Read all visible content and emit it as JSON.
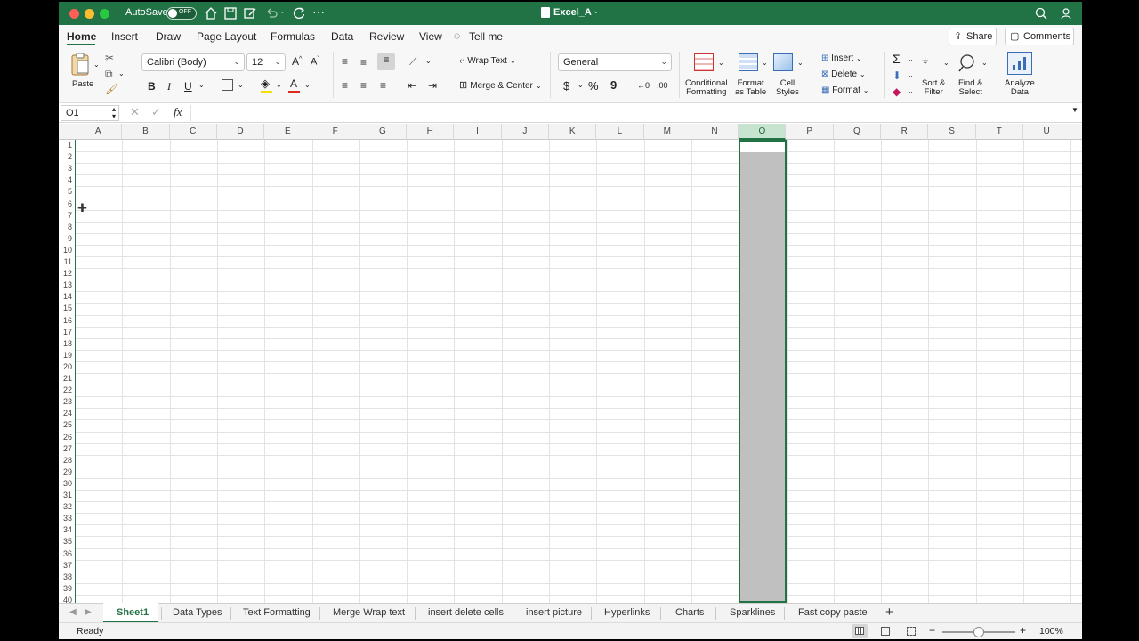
{
  "window": {
    "title": "Excel_A",
    "autosave_label": "AutoSave",
    "autosave_state": "OFF",
    "colors": {
      "brand": "#217346",
      "selection": "#c0c0c0"
    }
  },
  "menu_tabs": [
    "Home",
    "Insert",
    "Draw",
    "Page Layout",
    "Formulas",
    "Data",
    "Review",
    "View",
    "Tell me"
  ],
  "actions": {
    "share": "Share",
    "comments": "Comments"
  },
  "ribbon": {
    "paste": "Paste",
    "font_name": "Calibri (Body)",
    "font_size": "12",
    "bold": "B",
    "italic": "I",
    "underline": "U",
    "wrap_text": "Wrap Text",
    "merge_center": "Merge & Center",
    "number_format": "General",
    "currency": "$",
    "percent": "%",
    "comma": "9",
    "inc_decimal": "←0",
    "dec_decimal": ".00",
    "conditional_formatting": [
      "Conditional",
      "Formatting"
    ],
    "format_as_table": [
      "Format",
      "as Table"
    ],
    "cell_styles": [
      "Cell",
      "Styles"
    ],
    "insert": "Insert",
    "delete": "Delete",
    "format": "Format",
    "sort_filter": [
      "Sort &",
      "Filter"
    ],
    "find_select": [
      "Find &",
      "Select"
    ],
    "analyze_data": [
      "Analyze",
      "Data"
    ]
  },
  "formula_bar": {
    "name_box": "O1",
    "fx": "fx",
    "formula": ""
  },
  "columns": [
    "A",
    "B",
    "C",
    "D",
    "E",
    "F",
    "G",
    "H",
    "I",
    "J",
    "K",
    "L",
    "M",
    "N",
    "O",
    "P",
    "Q",
    "R",
    "S",
    "T",
    "U"
  ],
  "selected_column": "O",
  "rows": [
    "1",
    "2",
    "3",
    "4",
    "5",
    "6",
    "7",
    "8",
    "9",
    "10",
    "11",
    "12",
    "13",
    "14",
    "15",
    "16",
    "17",
    "18",
    "19",
    "20",
    "21",
    "22",
    "23",
    "24",
    "25",
    "26",
    "27",
    "28",
    "29",
    "30",
    "31",
    "32",
    "33",
    "34",
    "35",
    "36",
    "37",
    "38",
    "39",
    "40"
  ],
  "sheet_tabs": [
    "Sheet1",
    "Data Types",
    "Text Formatting",
    "Merge Wrap text",
    "insert delete cells",
    "insert picture",
    "Hyperlinks",
    "Charts",
    "Sparklines",
    "Fast copy paste"
  ],
  "active_sheet": "Sheet1",
  "status": {
    "ready": "Ready",
    "zoom": "100%",
    "zoom_level": 0.5
  }
}
